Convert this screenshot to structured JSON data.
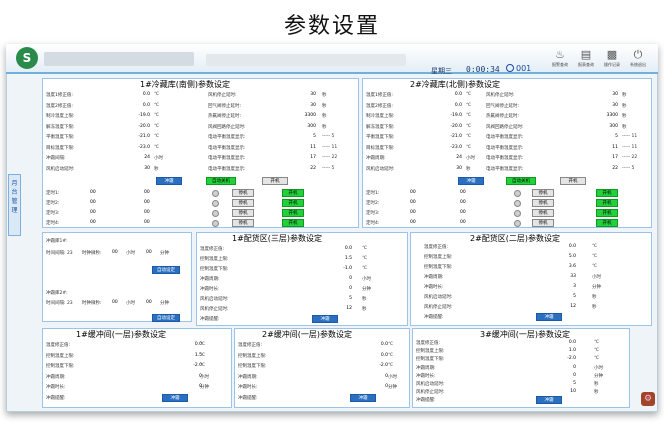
{
  "page_title": "参数设置",
  "header": {
    "weekday": "星期三",
    "time": "0:00:34",
    "user_icon": "user-icon",
    "user": "001",
    "toolbar": [
      {
        "icon": "bell-icon",
        "label": "报警查询"
      },
      {
        "icon": "book-icon",
        "label": "报表查询"
      },
      {
        "icon": "clipboard-icon",
        "label": "操作记录"
      },
      {
        "icon": "power-icon",
        "label": "系统退出"
      }
    ]
  },
  "sidebar": {
    "label": "月台管理"
  },
  "colors": {
    "accent": "#2a6fc0",
    "green": "#22d03a",
    "gray": "#e4e4e4",
    "border": "#9ec3e6"
  },
  "cold_south": {
    "title": "1#冷藏库(南侧)参数设定",
    "left": [
      [
        "温度1修正值:",
        "0.0",
        "℃"
      ],
      [
        "温度2修正值:",
        "0.0",
        "℃"
      ],
      [
        "制冷温度上限:",
        "-19.0",
        "℃"
      ],
      [
        "解冻温度下限:",
        "-20.0",
        "℃"
      ],
      [
        "平衡温度下限:",
        "-21.0",
        "℃"
      ],
      [
        "目标温度下限:",
        "-23.0",
        "℃"
      ],
      [
        "冲霜间隔:",
        "24",
        "小时"
      ],
      [
        "风机启动延时:",
        "30",
        "秒"
      ]
    ],
    "right": [
      [
        "风机停止延时:",
        "30",
        "秒"
      ],
      [
        "回气阀停止延时:",
        "30",
        "秒"
      ],
      [
        "热氟阀停止延时:",
        "3300",
        "秒"
      ],
      [
        "风阀回路停止延时:",
        "300",
        "秒"
      ],
      [
        "电动平衡温度显示:",
        "5",
        "----- 5"
      ],
      [
        "电动平衡温度显示:",
        "11",
        "----- 11"
      ],
      [
        "电动平衡温度显示:",
        "17",
        "----- 22"
      ],
      [
        "电动平衡温度显示:",
        "22",
        "----- 5"
      ]
    ],
    "defrost_btn": "冲霜",
    "run_btn": "自动关机",
    "on_btn": "开机",
    "timers": [
      [
        "定时1:",
        "00",
        "00"
      ],
      [
        "定时2:",
        "00",
        "00"
      ],
      [
        "定时3:",
        "00",
        "00"
      ],
      [
        "定时4:",
        "00",
        "00"
      ]
    ],
    "stop": "停机",
    "start": "开机"
  },
  "cold_north": {
    "title": "2#冷藏库(北侧)参数设定",
    "left": [
      [
        "温度1修正值:",
        "0.0",
        "℃"
      ],
      [
        "温度2修正值:",
        "0.0",
        "℃"
      ],
      [
        "制冷温度上限:",
        "-19.0",
        "℃"
      ],
      [
        "解冻温度下限:",
        "-20.0",
        "℃"
      ],
      [
        "平衡温度下限:",
        "-21.0",
        "℃"
      ],
      [
        "目标温度下限:",
        "-23.0",
        "℃"
      ],
      [
        "冲霜周期:",
        "24",
        "小时"
      ],
      [
        "风机启动延时:",
        "30",
        "秒"
      ]
    ],
    "right": [
      [
        "风机停止延时:",
        "30",
        "秒"
      ],
      [
        "回气阀停止延时:",
        "30",
        "秒"
      ],
      [
        "热氟阀停止延时:",
        "3300",
        "秒"
      ],
      [
        "风阀回路停止延时:",
        "300",
        "秒"
      ],
      [
        "电动平衡温度显示:",
        "5",
        "----- 11"
      ],
      [
        "电动平衡温度显示:",
        "11",
        "----- 11"
      ],
      [
        "电动平衡温度显示:",
        "17",
        "----- 22"
      ],
      [
        "电动平衡温度显示:",
        "22",
        "----- 5"
      ]
    ],
    "defrost_btn": "冲霜",
    "run_btn": "自动关机",
    "on_btn": "开机",
    "timers": [
      [
        "定时1:",
        "00",
        "00"
      ],
      [
        "定时2:",
        "00",
        "00"
      ],
      [
        "定时3:",
        "00",
        "00"
      ],
      [
        "定时4:",
        "00",
        "00"
      ]
    ],
    "stop": "停机",
    "start": "开机"
  },
  "defrost_left": {
    "label1": "冲霜库1#:",
    "interval": "时间间隔: 23",
    "delay1": "时钟微秒:",
    "v1": "00",
    "unit1": "小时",
    "v2": "00",
    "unit2": "分钟",
    "btn1": "自动设定",
    "label2": "冲霜库2#:",
    "btn2": "自动设定"
  },
  "zone1": {
    "title": "1#配货区(三层)参数设定",
    "rows": [
      [
        "温度修正值:",
        "0.0",
        "℃"
      ],
      [
        "控制温度上限:",
        "1.5",
        "℃"
      ],
      [
        "控制温度下限:",
        "-1.0",
        "℃"
      ],
      [
        "冲霜周期:",
        "0",
        "小时"
      ],
      [
        "冲霜时长:",
        "0",
        "分钟"
      ],
      [
        "风机启动延时:",
        "5",
        "秒"
      ],
      [
        "风机停止延时:",
        "12",
        "秒"
      ],
      [
        "冲霜提醒:",
        "冲霜",
        ""
      ]
    ]
  },
  "zone2": {
    "title": "2#配货区(二层)参数设定",
    "rows": [
      [
        "温度修正值:",
        "0.0",
        "℃"
      ],
      [
        "控制温度上限:",
        "5.0",
        "℃"
      ],
      [
        "控制温度下限:",
        "3.6",
        "℃"
      ],
      [
        "冲霜周期:",
        "33",
        "小时"
      ],
      [
        "冲霜时长:",
        "3",
        "分钟"
      ],
      [
        "风机启动延时:",
        "5",
        "秒"
      ],
      [
        "风机停止延时:",
        "12",
        "秒"
      ],
      [
        "冲霜提醒:",
        "冲霜",
        ""
      ]
    ]
  },
  "buffer1": {
    "title": "1#缓冲间(一层)参数设定",
    "rows": [
      [
        "温度修正值:",
        "0.0",
        "℃"
      ],
      [
        "控制温度上限:",
        "1.5",
        "℃"
      ],
      [
        "控制温度下限:",
        "-2.0",
        "℃"
      ],
      [
        "冲霜周期:",
        "0",
        "小时"
      ],
      [
        "冲霜时长:",
        "0",
        "分钟"
      ],
      [
        "冲霜提醒:",
        "冲霜",
        ""
      ]
    ]
  },
  "buffer2": {
    "title": "2#缓冲间(一层)参数设定",
    "rows": [
      [
        "温度修正值:",
        "0.0",
        "℃"
      ],
      [
        "控制温度上限:",
        "0.0",
        "℃"
      ],
      [
        "控制温度下限:",
        "-2.0",
        "℃"
      ],
      [
        "冲霜周期:",
        "0",
        "小时"
      ],
      [
        "冲霜时长:",
        "0",
        "分钟"
      ],
      [
        "冲霜提醒:",
        "冲霜",
        ""
      ]
    ]
  },
  "buffer3": {
    "title": "3#缓冲间(一层)参数设定",
    "rows": [
      [
        "温度修正值:",
        "0.0",
        "℃"
      ],
      [
        "控制温度上限:",
        "1.0",
        "℃"
      ],
      [
        "控制温度下限:",
        "-2.0",
        "℃"
      ],
      [
        "冲霜周期:",
        "0",
        "小时"
      ],
      [
        "冲霜时长:",
        "0",
        "分钟"
      ],
      [
        "风机启动延时:",
        "5",
        "秒"
      ],
      [
        "风机停止延时:",
        "10",
        "秒"
      ],
      [
        "冲霜提醒:",
        "冲霜",
        ""
      ]
    ]
  }
}
